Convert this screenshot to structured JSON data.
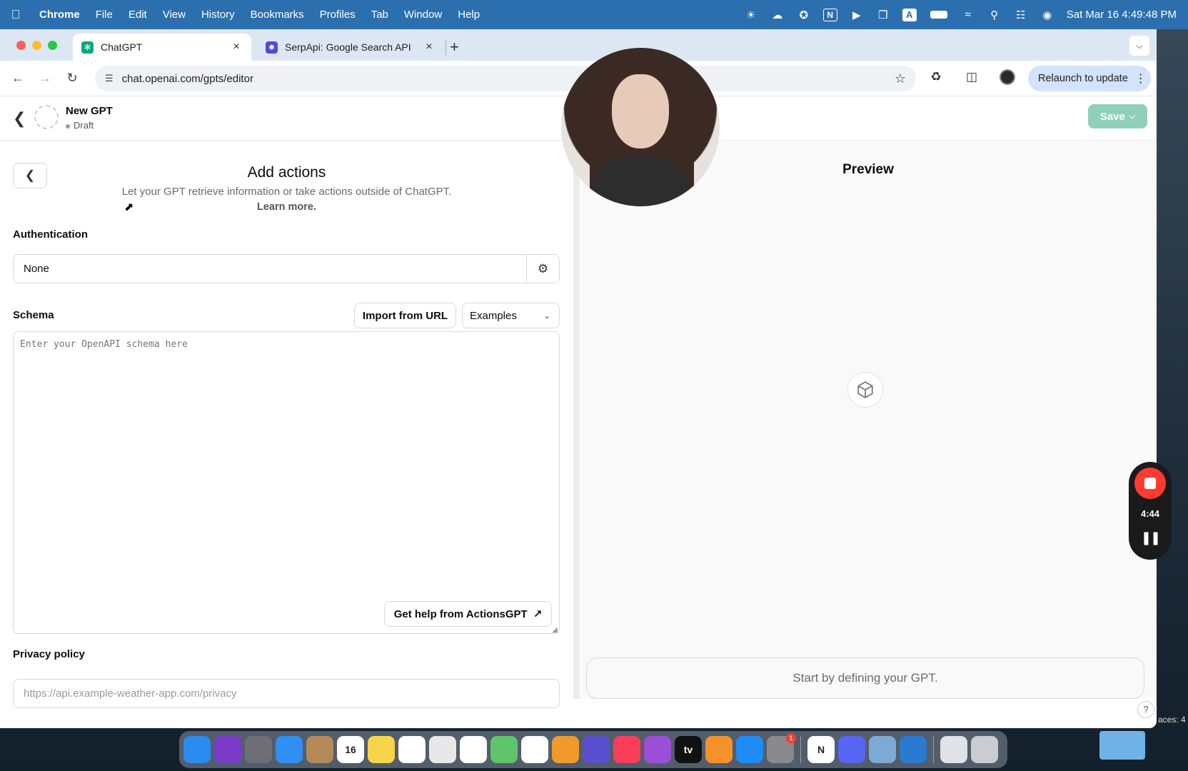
{
  "menubar": {
    "apple": "",
    "items": [
      "Chrome",
      "File",
      "Edit",
      "View",
      "History",
      "Bookmarks",
      "Profiles",
      "Tab",
      "Window",
      "Help"
    ],
    "status_icons": [
      "brightness-icon",
      "cloud-record-icon",
      "fan-icon",
      "notion-icon",
      "play-icon",
      "screens-icon",
      "keyboard-a-icon",
      "battery-icon",
      "wifi-icon",
      "spotlight-icon",
      "control-center-icon",
      "siri-icon"
    ],
    "keyboard_label": "A",
    "notion_label": "N",
    "datetime": "Sat Mar 16  4:49:48 PM"
  },
  "browser": {
    "tabs": [
      {
        "title": "ChatGPT",
        "favicon": "chatgpt-icon",
        "active": true
      },
      {
        "title": "SerpApi: Google Search API",
        "favicon": "serpapi-icon",
        "active": false
      }
    ],
    "close_glyph": "×",
    "new_tab_glyph": "+",
    "url": "chat.openai.com/gpts/editor",
    "relaunch_label": "Relaunch to update"
  },
  "app": {
    "gpt_name": "New GPT",
    "gpt_status": "Draft",
    "save_label": "Save"
  },
  "editor": {
    "title": "Add actions",
    "description": "Let your GPT retrieve information or take actions outside of ChatGPT.",
    "learn_more": "Learn more.",
    "authentication_label": "Authentication",
    "authentication_value": "None",
    "schema_label": "Schema",
    "import_label": "Import from URL",
    "examples_label": "Examples",
    "schema_placeholder": "Enter your OpenAPI schema here",
    "help_label": "Get help from ActionsGPT",
    "privacy_label": "Privacy policy",
    "privacy_placeholder": "https://api.example-weather-app.com/privacy"
  },
  "preview": {
    "title": "Preview",
    "start_text": "Start by defining your GPT.",
    "help_glyph": "?"
  },
  "recorder": {
    "time": "4:44"
  },
  "desktop": {
    "side_text": "aces: 4"
  },
  "dock": {
    "apps": [
      {
        "name": "finder",
        "color": "#2b8cf0"
      },
      {
        "name": "siri",
        "color": "#7a3cc8"
      },
      {
        "name": "launchpad",
        "color": "#6e6e76"
      },
      {
        "name": "safari",
        "color": "#2f8ff2"
      },
      {
        "name": "contacts",
        "color": "#b38a58"
      },
      {
        "name": "calendar",
        "color": "#ffffff",
        "label": "16"
      },
      {
        "name": "notes",
        "color": "#f7d54a"
      },
      {
        "name": "freeform",
        "color": "#ffffff"
      },
      {
        "name": "chrome",
        "color": "#e8e8e8"
      },
      {
        "name": "reminders",
        "color": "#ffffff"
      },
      {
        "name": "maps",
        "color": "#5fc46a"
      },
      {
        "name": "photos",
        "color": "#ffffff"
      },
      {
        "name": "pages",
        "color": "#f09a2c"
      },
      {
        "name": "imovie",
        "color": "#5a4fd0"
      },
      {
        "name": "music",
        "color": "#fa3e5a"
      },
      {
        "name": "podcasts",
        "color": "#9a4fd6"
      },
      {
        "name": "tv",
        "color": "#111111",
        "label": "tv"
      },
      {
        "name": "books",
        "color": "#f3922b"
      },
      {
        "name": "app-store",
        "color": "#1d8cf5"
      },
      {
        "name": "system-settings",
        "color": "#8a8a8e",
        "badge": "1"
      },
      {
        "name": "notion",
        "color": "#ffffff",
        "label": "N"
      },
      {
        "name": "discord",
        "color": "#5865f2"
      },
      {
        "name": "preview",
        "color": "#7ca9d6"
      },
      {
        "name": "vscode",
        "color": "#2a7ad3"
      },
      {
        "name": "finder-window",
        "color": "#dfe3e8"
      },
      {
        "name": "trash",
        "color": "#c9ccd0"
      }
    ]
  }
}
